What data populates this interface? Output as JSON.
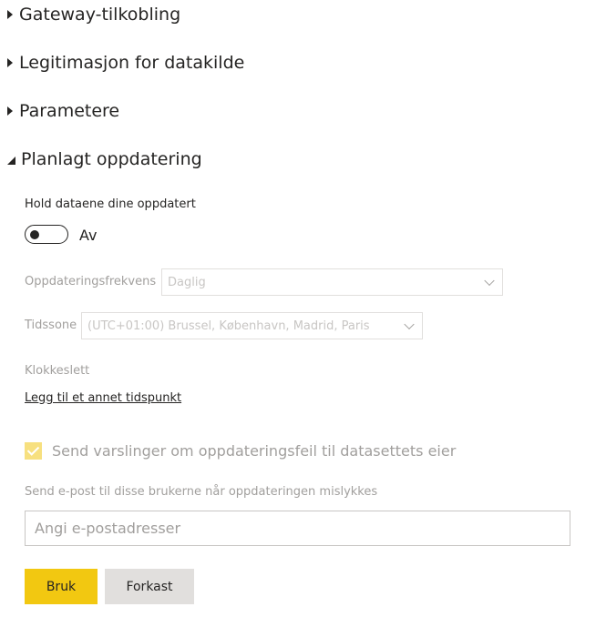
{
  "sections": [
    {
      "label": "Gateway-tilkobling",
      "expanded": false
    },
    {
      "label": "Legitimasjon for datakilde",
      "expanded": false
    },
    {
      "label": "Parametere",
      "expanded": false
    },
    {
      "label": "Planlagt oppdatering",
      "expanded": true
    }
  ],
  "refresh": {
    "keep_updated_label": "Hold dataene dine oppdatert",
    "toggle_state": "Av",
    "frequency_label": "Oppdateringsfrekvens",
    "frequency_value": "Daglig",
    "timezone_label": "Tidssone",
    "timezone_value": "(UTC+01:00) Brussel, København, Madrid, Paris",
    "time_label": "Klokkeslett",
    "add_time_link": "Legg til et annet tidspunkt",
    "notify_owner_label": "Send varslinger om oppdateringsfeil til datasettets eier",
    "notify_owner_checked": true,
    "email_users_label": "Send e-post til disse brukerne når oppdateringen mislykkes",
    "email_placeholder": "Angi e-postadresser"
  },
  "actions": {
    "apply_label": "Bruk",
    "discard_label": "Forkast"
  },
  "colors": {
    "accent": "#f2c811",
    "checkbox_disabled": "#f7e07f",
    "text": "#252423",
    "text_disabled": "#a19f9d"
  }
}
